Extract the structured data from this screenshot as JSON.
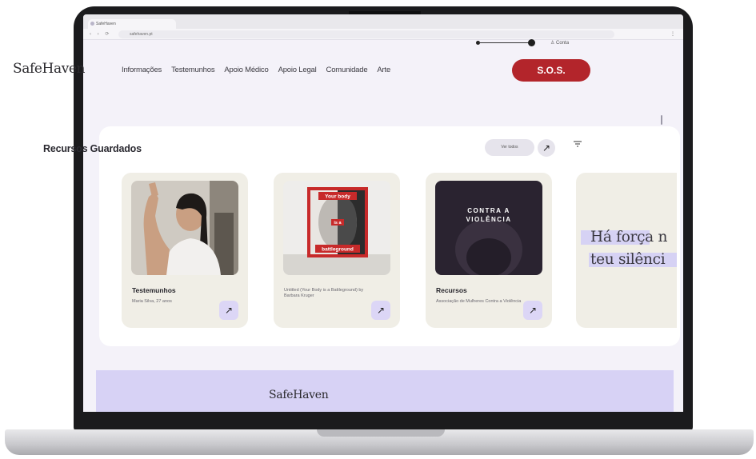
{
  "browser": {
    "tab_title": "SafeHaven",
    "url": "safehaven.pt",
    "nav_arrows": "‹ › ⟳",
    "tools": "⋮"
  },
  "accessibility": {
    "account_label": "Conta"
  },
  "site": {
    "logo": "SafeHaven",
    "nav": [
      "Informações",
      "Testemunhos",
      "Apoio Médico",
      "Apoio Legal",
      "Comunidade",
      "Arte"
    ],
    "sos_label": "S.O.S."
  },
  "saved_resources": {
    "title": "Recursos Guardados",
    "see_all_label": "Ver todos",
    "cards": [
      {
        "category": "Testemunhos",
        "subtitle": "Maria Silva, 27 anos",
        "image": "photo-woman-waving"
      },
      {
        "category": "",
        "subtitle": "Untitled (Your Body is a Battleground) by Barbara Kruger",
        "image": "artwork-your-body"
      },
      {
        "category": "Recursos",
        "subtitle": "Associação de Mulheres Contra a Violência",
        "image": "poster-contra-a-violencia",
        "image_text": [
          "CONTRA A",
          "VIOLÊNCIA"
        ]
      }
    ],
    "quote_lines": [
      "Há força n",
      "teu silênci"
    ]
  },
  "artwork": {
    "top": "Your body",
    "middle": "is a",
    "bottom": "battleground"
  },
  "footer": {
    "logo": "SafeHaven"
  },
  "colors": {
    "sos_red": "#b3252b",
    "lavender": "#d7d2f5",
    "card_bg": "#f0eee6",
    "arrow_bg": "#dcd6f6"
  }
}
